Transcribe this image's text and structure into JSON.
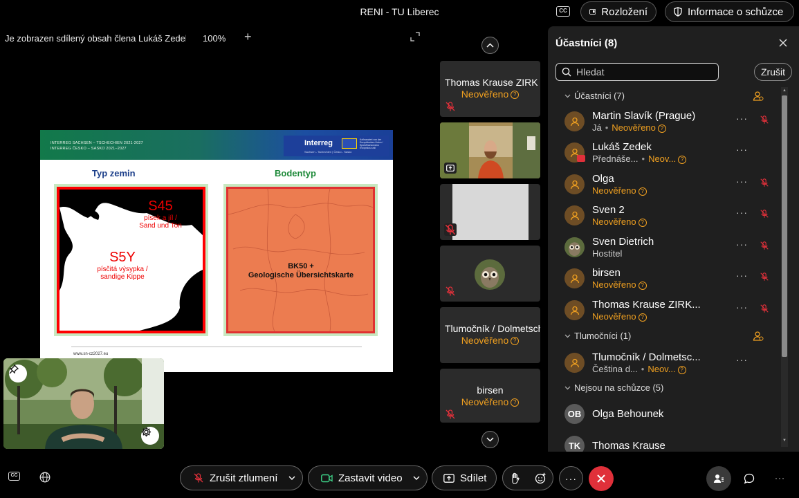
{
  "window": {
    "title": "RENI - TU Liberec"
  },
  "top_actions": {
    "cc": "CC",
    "layout": "Rozložení",
    "info": "Informace o schůzce"
  },
  "share": {
    "text": "Je zobrazen sdílený obsah člena Lukáš Zedek",
    "zoom": "100%",
    "zoom_in": "+"
  },
  "slide": {
    "header_line1": "INTERREG SACHSEN – TSCHECHIEN 2021-2027",
    "header_line2": "INTERREG ČESKO – SASKO 2021–2027",
    "logo": "Interreg",
    "logo_sub": "Sachsen - Tschechien | Česko - Sasko",
    "eu_text": "Kofinanziert von der Europäischen Union / Spolufinancováno Evropskou unií",
    "left_title": "Typ zemin",
    "right_title": "Bodentyp",
    "s45_code": "S45",
    "s45_line1": "písek a jíl /",
    "s45_line2": "Sand und Ton",
    "s5y_code": "S5Y",
    "s5y_line1": "písčitá výsypka /",
    "s5y_line2": "sandige Kippe",
    "right_line1": "BK50 +",
    "right_line2": "Geologische Übersichtskarte",
    "url": "www.sn-cz2027.eu"
  },
  "thumbnails": {
    "tile1_name": "Thomas Krause ZIRK",
    "tile1_status": "Neověřeno",
    "tile4_name": "Tlumočník / Dolmetscher",
    "tile4_status": "Neověřeno",
    "tile5_name": "birsen",
    "tile5_status": "Neověřeno"
  },
  "panel": {
    "title": "Účastníci (8)",
    "search_placeholder": "Hledat",
    "clear": "Zrušit",
    "sections": {
      "participants": "Účastníci (7)",
      "interpreters": "Tlumočníci (1)",
      "not_in_meeting": "Nejsou na schůzce (5)"
    },
    "participants": [
      {
        "name": "Martin Slavík (Prague)",
        "role": "Já",
        "status": "Neověřeno"
      },
      {
        "name": "Lukáš Zedek",
        "role": "Přednáše...",
        "status": "Neov..."
      },
      {
        "name": "Olga",
        "status": "Neověřeno"
      },
      {
        "name": "Sven 2",
        "status": "Neověřeno"
      },
      {
        "name": "Sven Dietrich",
        "role": "Hostitel"
      },
      {
        "name": "birsen",
        "status": "Neověřeno"
      },
      {
        "name": "Thomas Krause ZIRK...",
        "status": "Neověřeno"
      }
    ],
    "interpreters": [
      {
        "name": "Tlumočník / Dolmetsc...",
        "role": "Čeština d...",
        "status": "Neov..."
      }
    ],
    "absent": [
      {
        "initials": "OB",
        "name": "Olga Behounek"
      },
      {
        "initials": "TK",
        "name": "Thomas Krause"
      }
    ],
    "more": "···"
  },
  "toolbar": {
    "unmute": "Zrušit ztlumení",
    "stop_video": "Zastavit video",
    "share": "Sdílet",
    "more": "···",
    "cc": "CC"
  },
  "colors": {
    "accent": "#f0a020",
    "end": "#e0303a"
  }
}
